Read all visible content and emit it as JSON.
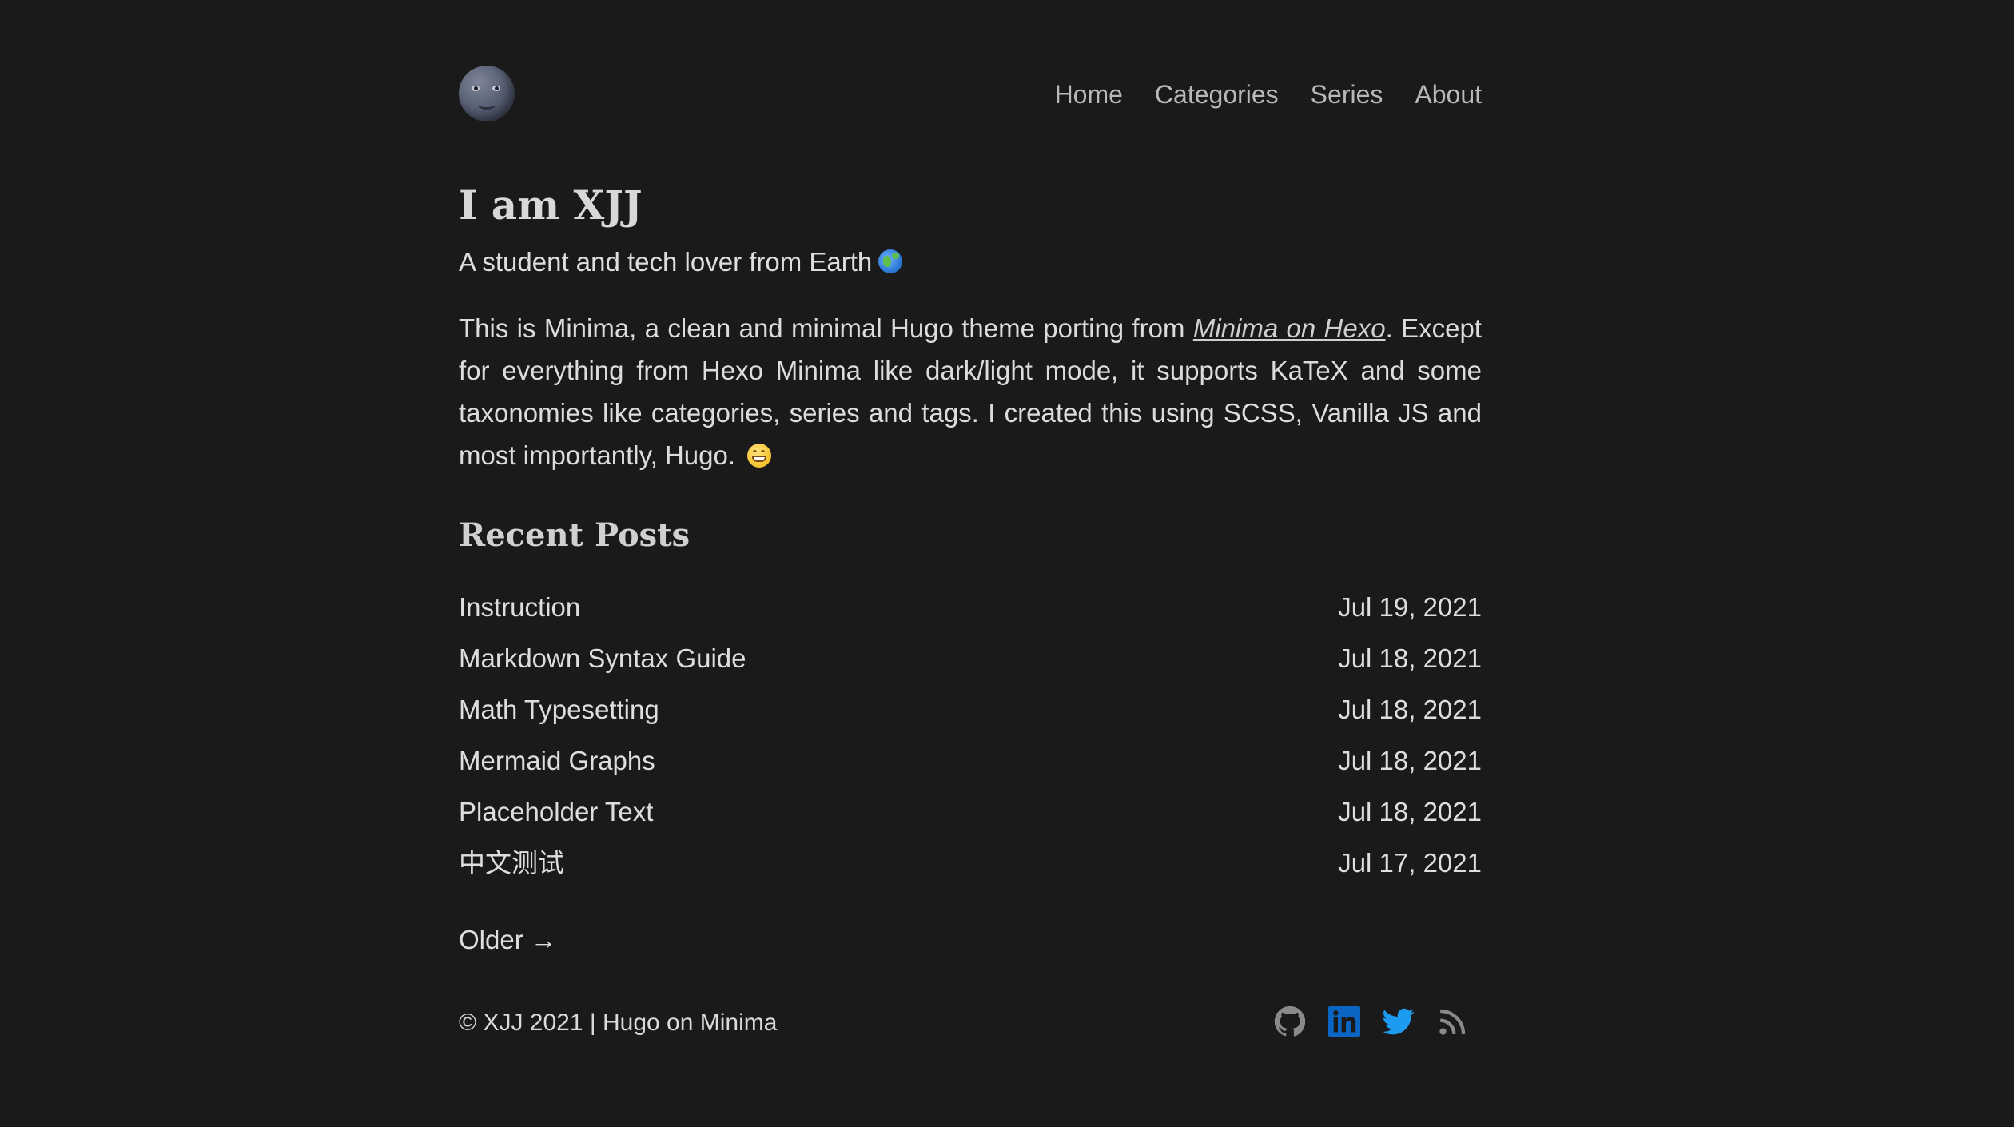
{
  "nav": {
    "items": [
      "Home",
      "Categories",
      "Series",
      "About"
    ]
  },
  "intro": {
    "title": "I am XJJ",
    "subtitle": "A student and tech lover from Earth",
    "description_before": "This is Minima, a clean and minimal Hugo theme porting from ",
    "description_link": "Minima on Hexo",
    "description_after": ". Except for everything from Hexo Minima like dark/light mode, it supports KaTeX and some taxonomies like categories, series and tags. I created this using SCSS, Vanilla JS and most importantly, Hugo."
  },
  "recent_posts": {
    "heading": "Recent Posts",
    "items": [
      {
        "title": "Instruction",
        "date": "Jul 19, 2021"
      },
      {
        "title": "Markdown Syntax Guide",
        "date": "Jul 18, 2021"
      },
      {
        "title": "Math Typesetting",
        "date": "Jul 18, 2021"
      },
      {
        "title": "Mermaid Graphs",
        "date": "Jul 18, 2021"
      },
      {
        "title": "Placeholder Text",
        "date": "Jul 18, 2021"
      },
      {
        "title": "中文测试",
        "date": "Jul 17, 2021"
      }
    ],
    "older_label": "Older →"
  },
  "footer": {
    "copyright": "© XJJ 2021 | Hugo on Minima",
    "social_icons": [
      "github-icon",
      "linkedin-icon",
      "twitter-icon",
      "rss-icon"
    ]
  },
  "colors": {
    "background": "#1a1a1a",
    "text": "#dcdcdc",
    "nav_text": "#b8b8b8",
    "linkedin": "#0a66c2",
    "twitter": "#1d9bf0",
    "muted_icon": "#8a8a8a"
  }
}
